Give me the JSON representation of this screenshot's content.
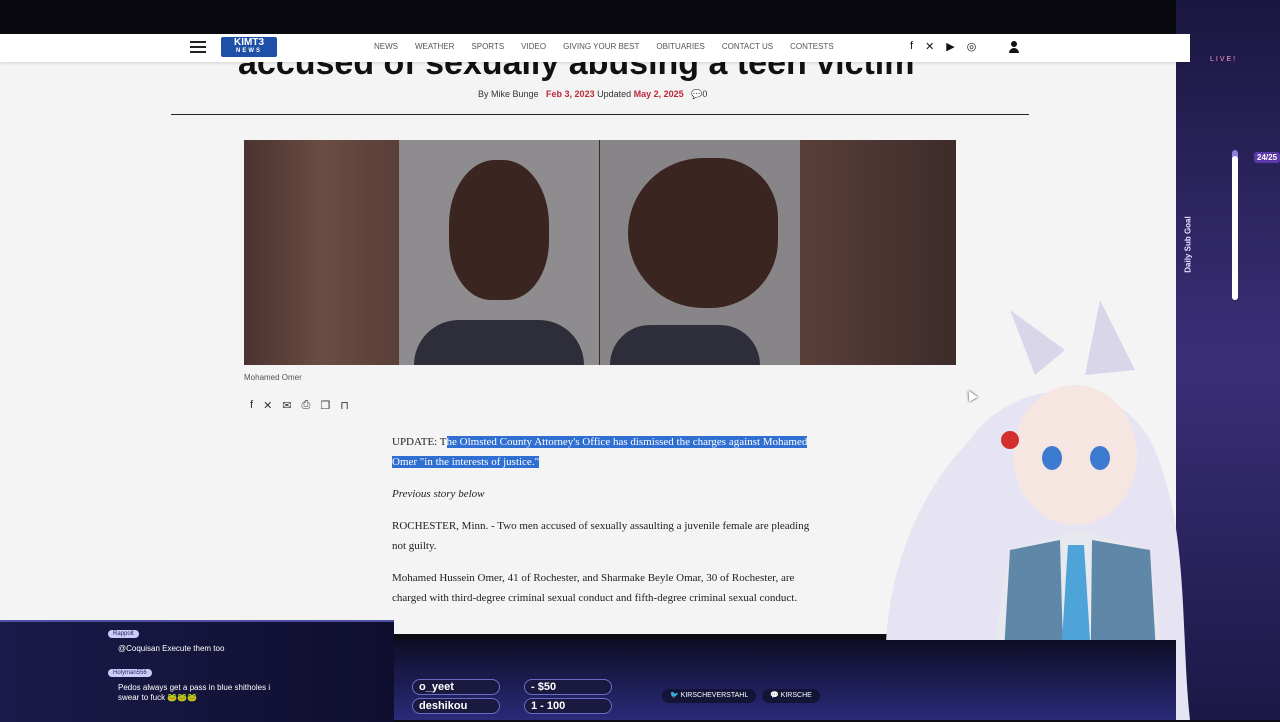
{
  "nav": {
    "logo_main": "KIMT3",
    "logo_sub": "NEWS",
    "links": [
      "NEWS",
      "WEATHER",
      "SPORTS",
      "VIDEO",
      "GIVING YOUR BEST",
      "OBITUARIES",
      "CONTACT US",
      "CONTESTS"
    ],
    "social_icons": [
      "facebook-icon",
      "x-icon",
      "youtube-icon",
      "instagram-icon"
    ]
  },
  "article": {
    "headline": "accused of sexually abusing a teen victim",
    "byline_prefix": "By Mike Bunge",
    "published": "Feb 3, 2023",
    "updated_label": "Updated",
    "updated": "May 2, 2025",
    "comments": "0",
    "caption": "Mohamed Omer",
    "update_prefix": "UPDATE: T",
    "update_highlight": "he Olmsted County Attorney's Office has dismissed the charges against Mohamed Omer \"in the interests of justice.\"",
    "prev": "Previous story below",
    "p1": "ROCHESTER, Minn. - Two men accused of sexually assaulting a juvenile female are pleading not guilty.",
    "p2": "Mohamed Hussein Omer, 41 of Rochester, and Sharmake Beyle Omar, 30 of Rochester, are charged with third-degree criminal sexual conduct and fifth-degree criminal sexual conduct."
  },
  "overlay": {
    "live": "LIVE!",
    "subgoal_label": "Daily Sub Goal",
    "subgoal_count": "24/25",
    "subgoal_progress": 0.96,
    "chat": [
      {
        "user": "Rappolt",
        "msg": "@Coquisan Execute them too"
      },
      {
        "user": "Holyman556",
        "msg1": "Pedos always get a pass in blue shitholes i",
        "msg2": "swear to fuck 🐸🐸🐸"
      }
    ],
    "recent_follower": "o_yeet",
    "recent_sub": "deshikou",
    "donation": "- $50",
    "bits": "1 - 100",
    "twitter": "KIRSCHEVERSTAHL",
    "discord": "KIRSCHE"
  }
}
